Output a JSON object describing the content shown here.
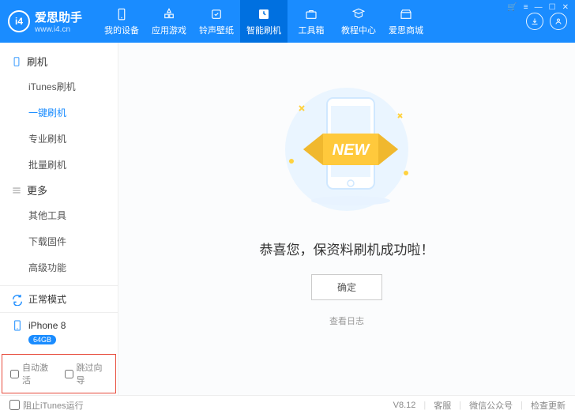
{
  "app": {
    "name": "爱思助手",
    "url": "www.i4.cn"
  },
  "nav": {
    "tabs": [
      {
        "label": "我的设备"
      },
      {
        "label": "应用游戏"
      },
      {
        "label": "铃声壁纸"
      },
      {
        "label": "智能刷机"
      },
      {
        "label": "工具箱"
      },
      {
        "label": "教程中心"
      },
      {
        "label": "爱思商城"
      }
    ]
  },
  "sidebar": {
    "group1": {
      "title": "刷机",
      "items": [
        "iTunes刷机",
        "一键刷机",
        "专业刷机",
        "批量刷机"
      ]
    },
    "group2": {
      "title": "更多",
      "items": [
        "其他工具",
        "下载固件",
        "高级功能"
      ]
    },
    "mode": "正常模式",
    "device": {
      "name": "iPhone 8",
      "capacity": "64GB"
    },
    "checks": {
      "auto_activate": "自动激活",
      "skip_guide": "跳过向导"
    }
  },
  "main": {
    "illus_text": "NEW",
    "success": "恭喜您，保资料刷机成功啦！",
    "confirm": "确定",
    "view_log": "查看日志"
  },
  "footer": {
    "block_itunes": "阻止iTunes运行",
    "version": "V8.12",
    "support": "客服",
    "wechat": "微信公众号",
    "update": "检查更新"
  }
}
